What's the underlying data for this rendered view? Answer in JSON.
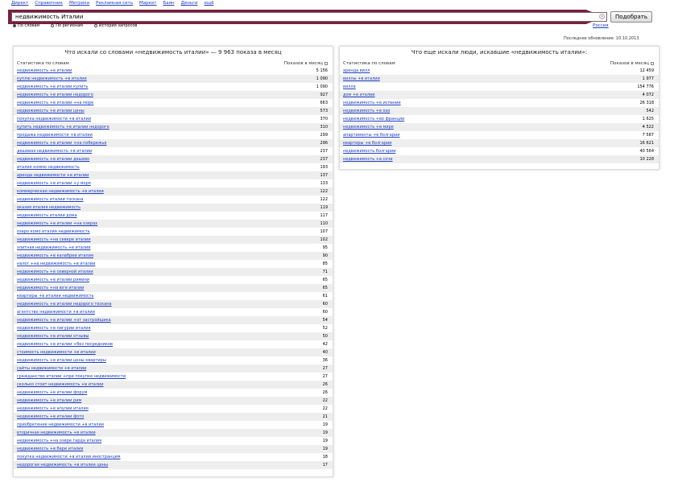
{
  "nav": [
    "Директ",
    "Справочник",
    "Метрика",
    "Рекламная сеть",
    "Маркет",
    "Баян",
    "Деньги",
    "ещё"
  ],
  "search": {
    "value": "недвижимость Италии",
    "button": "Подобрать",
    "region": "Россия"
  },
  "modes": [
    {
      "label": "По словам",
      "selected": true
    },
    {
      "label": "По регионам",
      "selected": false
    },
    {
      "label": "История запросов",
      "selected": false
    }
  ],
  "updated": "Последнее обновление: 10.10.2013",
  "left": {
    "title": "Что искали со словами «недвижимость италии» — 9 963 показа в месяц",
    "col_query": "Статистика по словам",
    "col_count": "Показов в месяц",
    "rows": [
      {
        "q": "недвижимость +в италии",
        "n": "5 156"
      },
      {
        "q": "куплю недвижимость +в италии",
        "n": "1 090"
      },
      {
        "q": "недвижимость +в италии купить",
        "n": "1 090"
      },
      {
        "q": "недвижимость +в италии недорого",
        "n": "927"
      },
      {
        "q": "недвижимость +в италии +на море",
        "n": "663"
      },
      {
        "q": "недвижимость +в италии цены",
        "n": "573"
      },
      {
        "q": "покупка недвижимости +в италии",
        "n": "370"
      },
      {
        "q": "купить недвижимость +в италии недорого",
        "n": "310"
      },
      {
        "q": "продажа недвижимости +в италии",
        "n": "299"
      },
      {
        "q": "недвижимость +в италии +на побережье",
        "n": "296"
      },
      {
        "q": "дешевая недвижимость +в италии",
        "n": "237"
      },
      {
        "q": "недвижимость +в италии дешево",
        "n": "237"
      },
      {
        "q": "италия коммо недвижимость",
        "n": "193"
      },
      {
        "q": "аренда недвижимости +в италии",
        "n": "137"
      },
      {
        "q": "недвижимость +в италии +у моря",
        "n": "133"
      },
      {
        "q": "коммерческая недвижимость +в италии",
        "n": "122"
      },
      {
        "q": "недвижимость италии тоскана",
        "n": "122"
      },
      {
        "q": "оказия италия недвижимость",
        "n": "119"
      },
      {
        "q": "недвижимость италии дома",
        "n": "117"
      },
      {
        "q": "недвижимость +в италии +на озерах",
        "n": "110"
      },
      {
        "q": "озеро комо италия недвижимость",
        "n": "107"
      },
      {
        "q": "недвижимость +на севере италии",
        "n": "102"
      },
      {
        "q": "элитная недвижимость +в италии",
        "n": "95"
      },
      {
        "q": "недвижимость +в калабрии италия",
        "n": "90"
      },
      {
        "q": "налог +на недвижимость +в италии",
        "n": "85"
      },
      {
        "q": "недвижимость +в северной италии",
        "n": "71"
      },
      {
        "q": "недвижимость +в италии римини",
        "n": "65"
      },
      {
        "q": "недвижимость +на юге италии",
        "n": "65"
      },
      {
        "q": "квартиры +в италии недвижимость",
        "n": "61"
      },
      {
        "q": "недвижимость +в италии недорого тоскана",
        "n": "60"
      },
      {
        "q": "агентство недвижимости +в италии",
        "n": "60"
      },
      {
        "q": "недвижимость +в италии +от застройщика",
        "n": "54"
      },
      {
        "q": "недвижимость +в лигурии италия",
        "n": "52"
      },
      {
        "q": "недвижимость +в италии отзывы",
        "n": "50"
      },
      {
        "q": "недвижимость +в италии +без посредников",
        "n": "42"
      },
      {
        "q": "стоимость недвижимости +в италии",
        "n": "40"
      },
      {
        "q": "недвижимость +в италии цены квартиры",
        "n": "36"
      },
      {
        "q": "сайты недвижимости +в италии",
        "n": "27"
      },
      {
        "q": "гражданство италии +при покупке недвижимости",
        "n": "27"
      },
      {
        "q": "сколько стоит недвижимость +в италии",
        "n": "26"
      },
      {
        "q": "недвижимость +в италии форум",
        "n": "26"
      },
      {
        "q": "недвижимость +в италии рим",
        "n": "22"
      },
      {
        "q": "недвижимость +в апулии италия",
        "n": "22"
      },
      {
        "q": "недвижимость +в италии фото",
        "n": "21"
      },
      {
        "q": "приобретение недвижимости +в италии",
        "n": "19"
      },
      {
        "q": "вторичная недвижимость +в италии",
        "n": "19"
      },
      {
        "q": "недвижимость +на озере гарда италия",
        "n": "19"
      },
      {
        "q": "недвижимость +в бари италия",
        "n": "19"
      },
      {
        "q": "покупка недвижимости +в италии иностранцем",
        "n": "18"
      },
      {
        "q": "недорогая недвижимость +в италии цены",
        "n": "17"
      }
    ]
  },
  "right": {
    "title": "Что еще искали люди, искавшие «недвижимость италии»:",
    "col_query": "Статистика по словам",
    "col_count": "Показов в месяц",
    "rows": [
      {
        "q": "аренда вилл",
        "n": "12 459"
      },
      {
        "q": "виллы +в италии",
        "n": "1 977"
      },
      {
        "q": "вилла",
        "n": "154 776"
      },
      {
        "q": "дом +в италии",
        "n": "4 072"
      },
      {
        "q": "недвижимость +в испании",
        "n": "26 318"
      },
      {
        "q": "недвижимость +в оаэ",
        "n": "542"
      },
      {
        "q": "недвижимость +во франции",
        "n": "1 625"
      },
      {
        "q": "недвижимость +в мире",
        "n": "4 522"
      },
      {
        "q": "апартаменты +в болгарии",
        "n": "7 587"
      },
      {
        "q": "квартиры +в болгарии",
        "n": "16 621"
      },
      {
        "q": "недвижимость болгарии",
        "n": "40 564"
      },
      {
        "q": "недвижимость +в сочи",
        "n": "10 228"
      }
    ]
  }
}
